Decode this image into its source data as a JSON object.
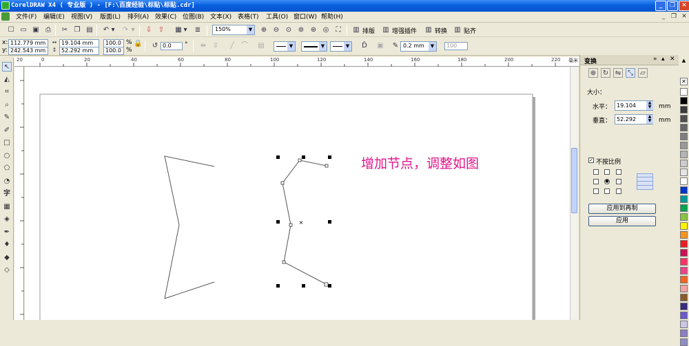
{
  "window": {
    "title": "CorelDRAW X4 ( 专业版 ) - [F:\\百度经验\\标贴\\标贴.cdr]"
  },
  "menu": [
    {
      "label": "文件(F)"
    },
    {
      "label": "编辑(E)"
    },
    {
      "label": "视图(V)"
    },
    {
      "label": "版面(L)"
    },
    {
      "label": "排列(A)"
    },
    {
      "label": "效果(C)"
    },
    {
      "label": "位图(B)"
    },
    {
      "label": "文本(X)"
    },
    {
      "label": "表格(T)"
    },
    {
      "label": "工具(O)"
    },
    {
      "label": "窗口(W)"
    },
    {
      "label": "帮助(H)"
    }
  ],
  "toolbar": {
    "zoom": "150%",
    "plugins": [
      "排版",
      "增强插件",
      "转换",
      "贴齐"
    ]
  },
  "property_bar": {
    "x_label": "x:",
    "x": "112.779 mm",
    "y_label": "y:",
    "y": "242.543 mm",
    "width": "19.104 mm",
    "height": "52.292 mm",
    "scale_x": "100.0",
    "scale_y": "100.0",
    "percent": "%",
    "rotation": "0.0",
    "degree": "°",
    "outline_width": "0.2 mm",
    "opacity": "100"
  },
  "ruler": {
    "h_ticks": [
      "20",
      "0",
      "20",
      "40",
      "60",
      "80",
      "100",
      "120",
      "140",
      "160",
      "180",
      "200",
      "220",
      "毫米"
    ]
  },
  "canvas": {
    "annotation": "增加节点，调整如图",
    "annotation_color": "#e0168c"
  },
  "docker": {
    "title": "变换",
    "size_label": "大小：",
    "horizontal_label": "水平：",
    "horizontal_value": "19.104",
    "vertical_label": "垂直：",
    "vertical_value": "52.292",
    "unit": "mm",
    "proportional_label": "不按比例",
    "apply_copy_button": "应用到再制",
    "apply_button": "应用"
  },
  "palette": [
    "#ffffff",
    "#000000",
    "#3b3b3b",
    "#4f4f4f",
    "#666666",
    "#7f7f7f",
    "#999999",
    "#b3b3b3",
    "#cccccc",
    "#e5e5e5",
    "#ffffff",
    "#0033cc",
    "#009999",
    "#00a54f",
    "#88c540",
    "#fff200",
    "#f7941d",
    "#ed1c24",
    "#cc1155",
    "#ff3366",
    "#ee4488",
    "#f26522",
    "#f4a3a3",
    "#8b5a2b",
    "#3a2d80",
    "#6a5acd",
    "#cbc6e8",
    "#8a7fc4",
    "#8e8ec6"
  ]
}
